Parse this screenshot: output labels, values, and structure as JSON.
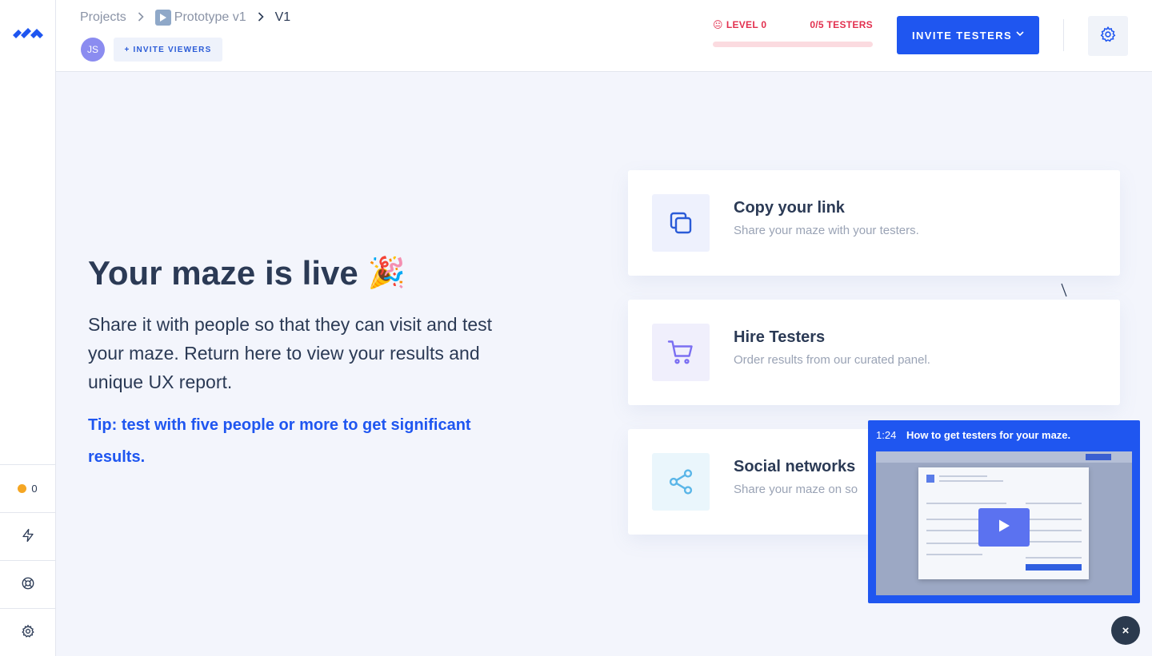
{
  "sidebar": {
    "logo_icon": "maze-logo-icon",
    "credits": "0",
    "items": [
      {
        "icon": "lightning-icon"
      },
      {
        "icon": "lifebuoy-icon"
      },
      {
        "icon": "gear-icon"
      }
    ]
  },
  "header": {
    "breadcrumb": {
      "projects": "Projects",
      "prototype": "Prototype v1",
      "version": "V1"
    },
    "avatar_initials": "JS",
    "invite_viewers_label": "+ INVITE VIEWERS",
    "level": {
      "emoji": "😐",
      "label": "LEVEL 0",
      "testers_label": "0/5 TESTERS",
      "progress_fraction": 0
    },
    "invite_testers_label": "INVITE TESTERS"
  },
  "main": {
    "title": "Your maze is live",
    "title_emoji": "🎉",
    "description": "Share it with people so that they can visit and test your maze. Return here to view your results and unique UX report.",
    "tip": "Tip: test with five people or more to get significant results.",
    "cards": [
      {
        "title": "Copy your link",
        "subtitle": "Share your maze with your testers.",
        "icon": "copy-icon"
      },
      {
        "title": "Hire Testers",
        "subtitle": "Order results from our curated panel.",
        "icon": "cart-icon"
      },
      {
        "title": "Social networks",
        "subtitle": "Share your maze on so",
        "icon": "share-icon"
      }
    ]
  },
  "video": {
    "duration": "1:24",
    "title": "How to get testers for your maze.",
    "close_label": "×"
  },
  "colors": {
    "accent": "#1f56f0",
    "level_red": "#e2304f",
    "text_dark": "#2b3a55",
    "text_muted": "#9aa3b5",
    "background": "#f3f5fc",
    "credit_dot": "#f5a623"
  }
}
